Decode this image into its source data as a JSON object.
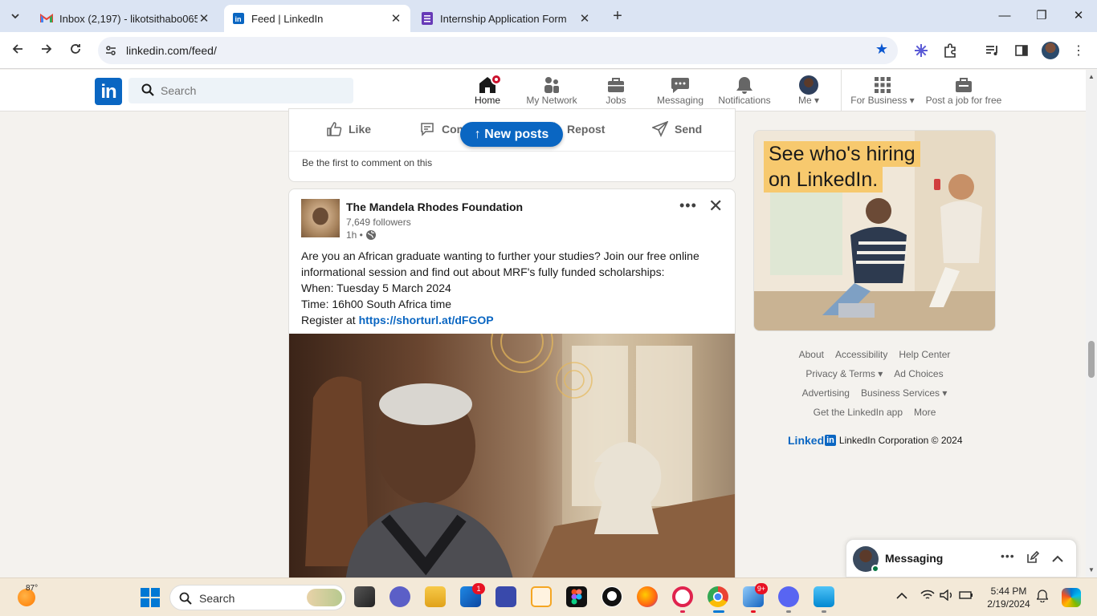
{
  "browser": {
    "tabs": [
      {
        "title": "Inbox (2,197) - likotsithabo065",
        "icon": "gmail-icon"
      },
      {
        "title": "Feed | LinkedIn",
        "icon": "linkedin-icon"
      },
      {
        "title": "Internship Application Form",
        "icon": "forms-icon"
      }
    ],
    "url": "linkedin.com/feed/",
    "accent_color": "#0b57d0"
  },
  "linkedin": {
    "logo_text": "in",
    "search_placeholder": "Search",
    "nav": [
      {
        "label": "Home"
      },
      {
        "label": "My Network"
      },
      {
        "label": "Jobs"
      },
      {
        "label": "Messaging"
      },
      {
        "label": "Notifications"
      },
      {
        "label": "Me"
      },
      {
        "label": "For Business"
      },
      {
        "label": "Post a job for free"
      }
    ],
    "brand_color": "#0a66c2"
  },
  "previous_post": {
    "actions": {
      "like": "Like",
      "comment": "Comment",
      "repost": "Repost",
      "send": "Send"
    },
    "comment_hint": "Be the first to comment on this"
  },
  "new_posts_label": "New posts",
  "post": {
    "author": "The Mandela Rhodes Foundation",
    "followers": "7,649 followers",
    "time": "1h •",
    "lines": [
      "Are you an African graduate wanting to further your studies? Join our free online informational session and find out about MRF's fully funded scholarships:",
      "When: Tuesday 5 March 2024",
      "Time: 16h00 South Africa time"
    ],
    "register_prefix": "Register at",
    "register_link": "https://shorturl.at/dFGOP"
  },
  "ad": {
    "headline_line1": "See who's hiring",
    "headline_line2": "on LinkedIn."
  },
  "footer": {
    "about": "About",
    "accessibility": "Accessibility",
    "help_center": "Help Center",
    "privacy_terms": "Privacy & Terms",
    "ad_choices": "Ad Choices",
    "advertising": "Advertising",
    "business_services": "Business Services",
    "get_app": "Get the LinkedIn app",
    "more": "More",
    "wordmark": "Linked",
    "wordmark_in": "in",
    "copyright": "LinkedIn Corporation © 2024"
  },
  "messaging": {
    "label": "Messaging"
  },
  "taskbar": {
    "temperature": "87°",
    "search_label": "Search",
    "time": "5:44 PM",
    "date": "2/19/2024",
    "badge_store": "1",
    "badge_app": "9+"
  }
}
